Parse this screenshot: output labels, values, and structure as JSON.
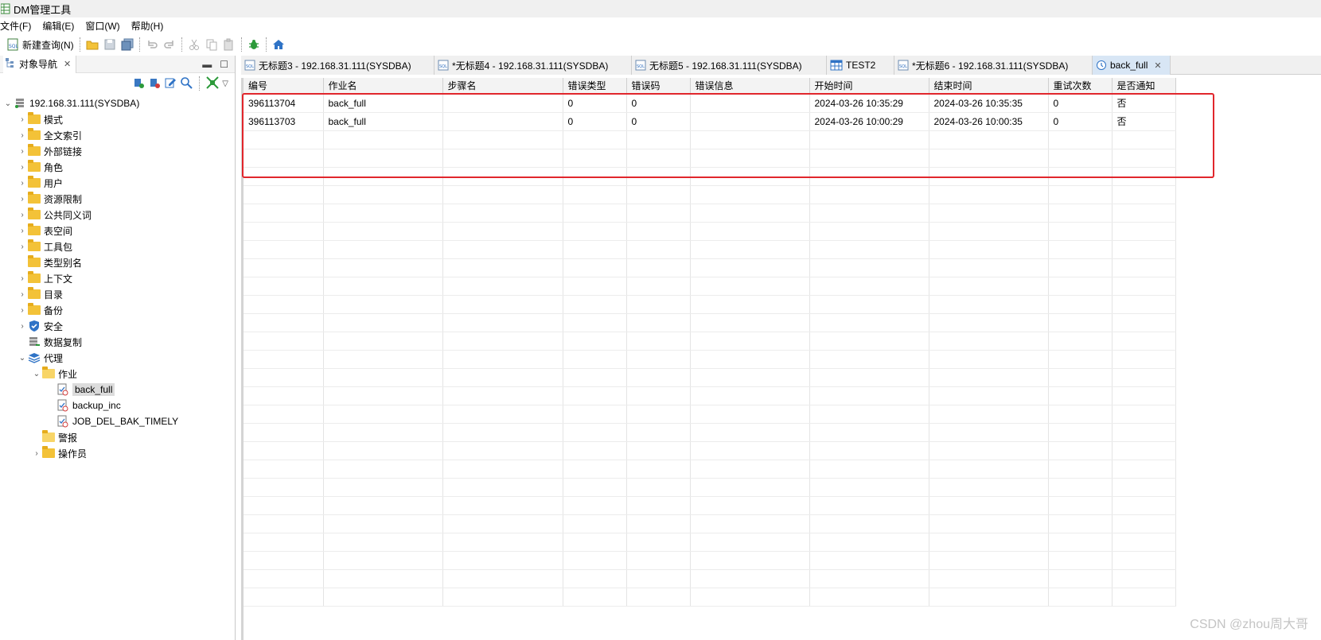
{
  "titlebar": {
    "title": "DM管理工具"
  },
  "menubar": {
    "items": [
      "文件(F)",
      "编辑(E)",
      "窗口(W)",
      "帮助(H)"
    ]
  },
  "toolbar": {
    "new_query_label": "新建查询(N)"
  },
  "navigator": {
    "tab_label": "对象导航",
    "tree": {
      "root": "192.168.31.111(SYSDBA)",
      "items": [
        "模式",
        "全文索引",
        "外部链接",
        "角色",
        "用户",
        "资源限制",
        "公共同义词",
        "表空间",
        "工具包",
        "类型别名",
        "上下文",
        "目录",
        "备份",
        "安全",
        "数据复制",
        "代理"
      ],
      "agent_children": [
        "作业",
        "警报",
        "操作员"
      ],
      "jobs": [
        "back_full",
        "backup_inc",
        "JOB_DEL_BAK_TIMELY"
      ]
    }
  },
  "editor_tabs": [
    {
      "label": "无标题3 - 192.168.31.111(SYSDBA)",
      "icon": "sql-icon"
    },
    {
      "label": "*无标题4 - 192.168.31.111(SYSDBA)",
      "icon": "sql-icon"
    },
    {
      "label": "无标题5 - 192.168.31.111(SYSDBA)",
      "icon": "sql-icon"
    },
    {
      "label": "TEST2",
      "icon": "table-icon"
    },
    {
      "label": "*无标题6 - 192.168.31.111(SYSDBA)",
      "icon": "sql-icon"
    },
    {
      "label": "back_full",
      "icon": "job-icon",
      "active": true
    }
  ],
  "grid": {
    "columns": [
      "编号",
      "作业名",
      "步骤名",
      "错误类型",
      "错误码",
      "错误信息",
      "开始时间",
      "结束时间",
      "重试次数",
      "是否通知"
    ],
    "rows": [
      [
        "396113704",
        "back_full",
        "",
        "0",
        "0",
        "",
        "2024-03-26 10:35:29",
        "2024-03-26 10:35:35",
        "0",
        "否"
      ],
      [
        "396113703",
        "back_full",
        "",
        "0",
        "0",
        "",
        "2024-03-26 10:00:29",
        "2024-03-26 10:00:35",
        "0",
        "否"
      ]
    ]
  },
  "watermark": "CSDN @zhou周大哥",
  "colors": {
    "highlight_box": "#e1262c",
    "active_tab": "#d8e6f5"
  }
}
